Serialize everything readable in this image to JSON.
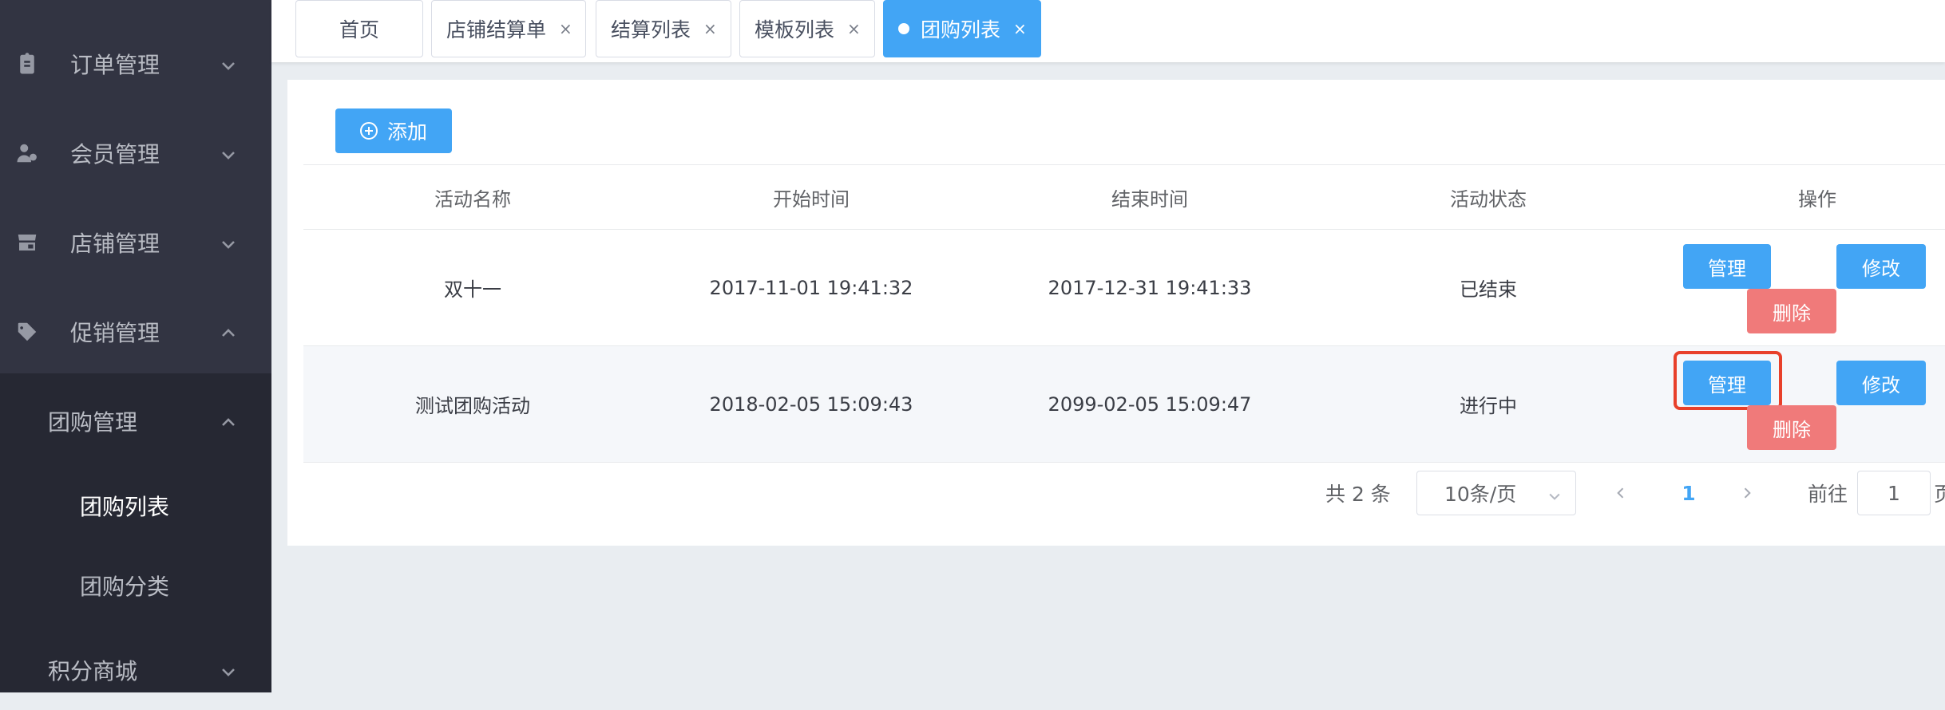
{
  "sidebar": {
    "menus": [
      {
        "label": "订单管理",
        "icon": "clipboard-icon",
        "expanded": false
      },
      {
        "label": "会员管理",
        "icon": "member-icon",
        "expanded": false
      },
      {
        "label": "店铺管理",
        "icon": "store-icon",
        "expanded": false
      },
      {
        "label": "促销管理",
        "icon": "tag-icon",
        "expanded": true
      }
    ],
    "submenu": {
      "label": "团购管理",
      "expanded": true
    },
    "leaves": [
      {
        "label": "团购列表",
        "active": true
      },
      {
        "label": "团购分类",
        "active": false
      }
    ],
    "last_menu": {
      "label": "积分商城",
      "expanded": false
    }
  },
  "tabs": [
    {
      "label": "首页",
      "closable": false
    },
    {
      "label": "店铺结算单",
      "closable": true
    },
    {
      "label": "结算列表",
      "closable": true
    },
    {
      "label": "模板列表",
      "closable": true
    },
    {
      "label": "团购列表",
      "closable": true,
      "active": true
    }
  ],
  "tab_close_glyph": "×",
  "toolbar": {
    "add_label": "添加"
  },
  "table": {
    "columns": [
      "活动名称",
      "开始时间",
      "结束时间",
      "活动状态",
      "操作"
    ],
    "rows": [
      {
        "name": "双十一",
        "start": "2017-11-01 19:41:32",
        "end": "2017-12-31 19:41:33",
        "status": "已结束"
      },
      {
        "name": "测试团购活动",
        "start": "2018-02-05 15:09:43",
        "end": "2099-02-05 15:09:47",
        "status": "进行中"
      }
    ],
    "actions": {
      "manage": "管理",
      "edit": "修改",
      "delete": "删除"
    }
  },
  "pagination": {
    "total_label": "共 2 条",
    "page_size": "10条/页",
    "current_page": "1",
    "goto_label": "前往",
    "goto_value": "1",
    "page_suffix": "页"
  },
  "colors": {
    "sidebar_bg": "#323442",
    "submenu_bg": "#262833",
    "primary": "#42a5f5",
    "danger": "#f07a7a",
    "highlight": "#e8402a"
  }
}
